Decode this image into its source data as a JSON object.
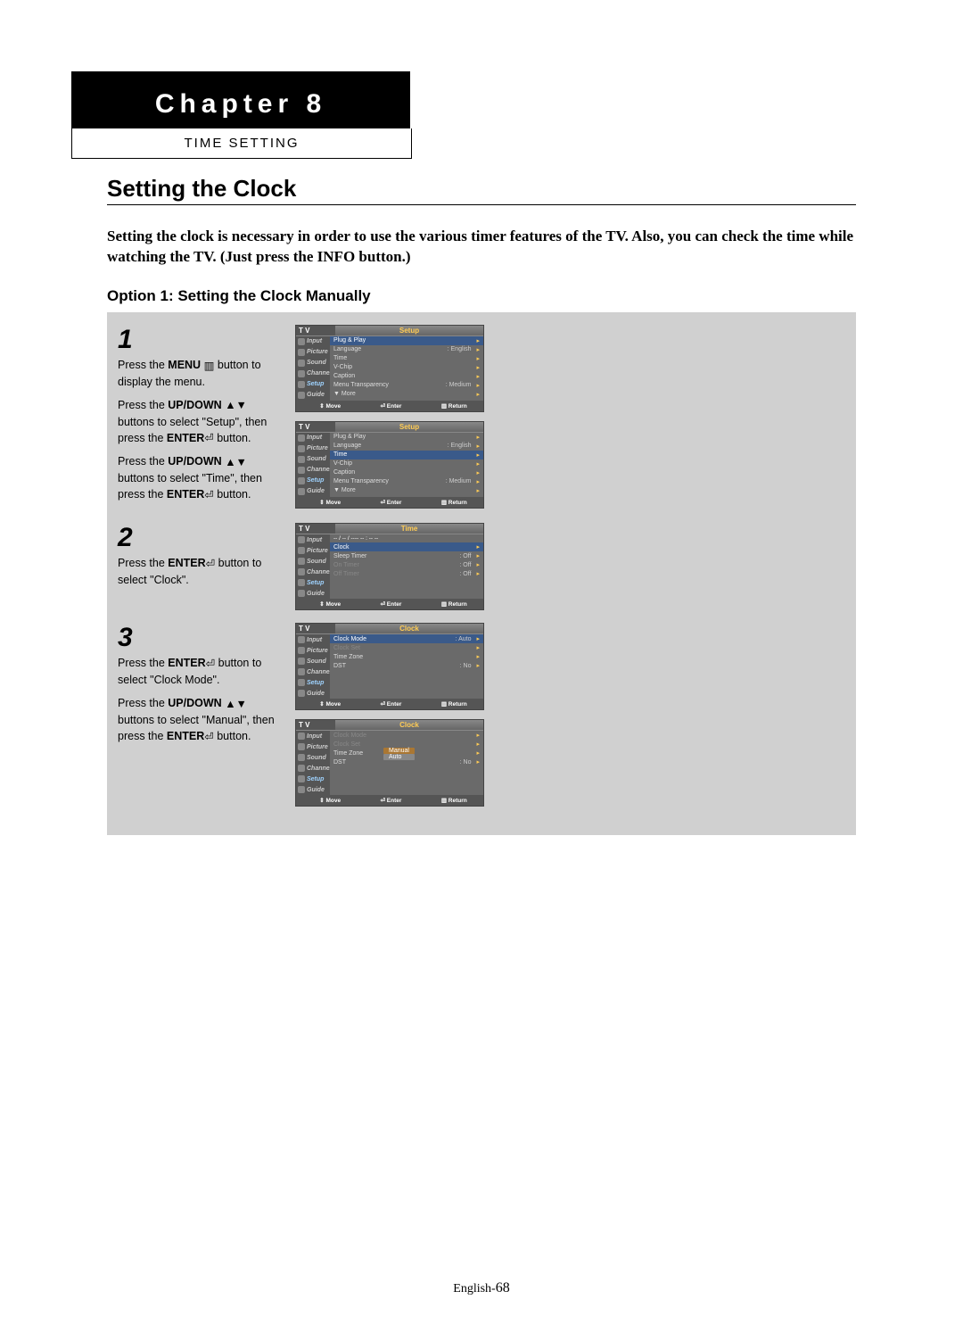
{
  "chapter": "Chapter 8",
  "subtitle": "TIME SETTING",
  "heading": "Setting the Clock",
  "intro": "Setting the clock is necessary in order to use the various timer features of the TV. Also, you can check the time while watching the TV. (Just press the INFO button.)",
  "option": "Option 1: Setting the Clock Manually",
  "steps": {
    "s1": {
      "num": "1",
      "p1a": "Press the ",
      "p1b": "MENU",
      "p1c": " button to display the menu.",
      "p2a": "Press the ",
      "p2b": "UP/DOWN",
      "p2c": " buttons to select \"Setup\", then press the ",
      "p2d": "ENTER",
      "p2e": " button.",
      "p3a": "Press the ",
      "p3b": "UP/DOWN",
      "p3c": " buttons to select \"Time\", then press the ",
      "p3d": "ENTER",
      "p3e": "  button."
    },
    "s2": {
      "num": "2",
      "p1a": "Press the ",
      "p1b": "ENTER",
      "p1c": " button to select \"Clock\"."
    },
    "s3": {
      "num": "3",
      "p1a": "Press the ",
      "p1b": "ENTER",
      "p1c": " button to select \"Clock Mode\".",
      "p2a": "Press the ",
      "p2b": "UP/DOWN",
      "p2c": " buttons to select \"Manual\", then press the ",
      "p2d": "ENTER",
      "p2e": " button."
    }
  },
  "tv": {
    "tv_label": "T V",
    "side": [
      "Input",
      "Picture",
      "Sound",
      "Channel",
      "Setup",
      "Guide"
    ],
    "setup_title": "Setup",
    "setup_items": [
      {
        "label": "Plug & Play",
        "val": ""
      },
      {
        "label": "Language",
        "val": ": English"
      },
      {
        "label": "Time",
        "val": ""
      },
      {
        "label": "V-Chip",
        "val": ""
      },
      {
        "label": "Caption",
        "val": ""
      },
      {
        "label": "Menu Transparency",
        "val": ": Medium"
      },
      {
        "label": "▼ More",
        "val": ""
      }
    ],
    "time_title": "Time",
    "time_header_text": "-- / -- / ---- -- : -- --",
    "time_items": [
      {
        "label": "Clock",
        "val": ""
      },
      {
        "label": "Sleep Timer",
        "val": ": Off"
      },
      {
        "label": "On Timer",
        "val": ": Off"
      },
      {
        "label": "Off Timer",
        "val": ": Off"
      }
    ],
    "clock_title": "Clock",
    "clock_items": [
      {
        "label": "Clock Mode",
        "val": ": Auto"
      },
      {
        "label": "Clock Set",
        "val": ""
      },
      {
        "label": "Time Zone",
        "val": ""
      },
      {
        "label": "DST",
        "val": ": No"
      }
    ],
    "clock_items2": [
      {
        "label": "Clock Mode",
        "val": ""
      },
      {
        "label": "Clock Set",
        "val": ""
      },
      {
        "label": "Time Zone",
        "val": ""
      },
      {
        "label": "DST",
        "val": ": No"
      }
    ],
    "dd_manual": "Manual",
    "dd_auto": "Auto",
    "foot_move": "Move",
    "foot_enter": "Enter",
    "foot_return": "Return"
  },
  "footer_lang": "English-",
  "footer_page": "68"
}
